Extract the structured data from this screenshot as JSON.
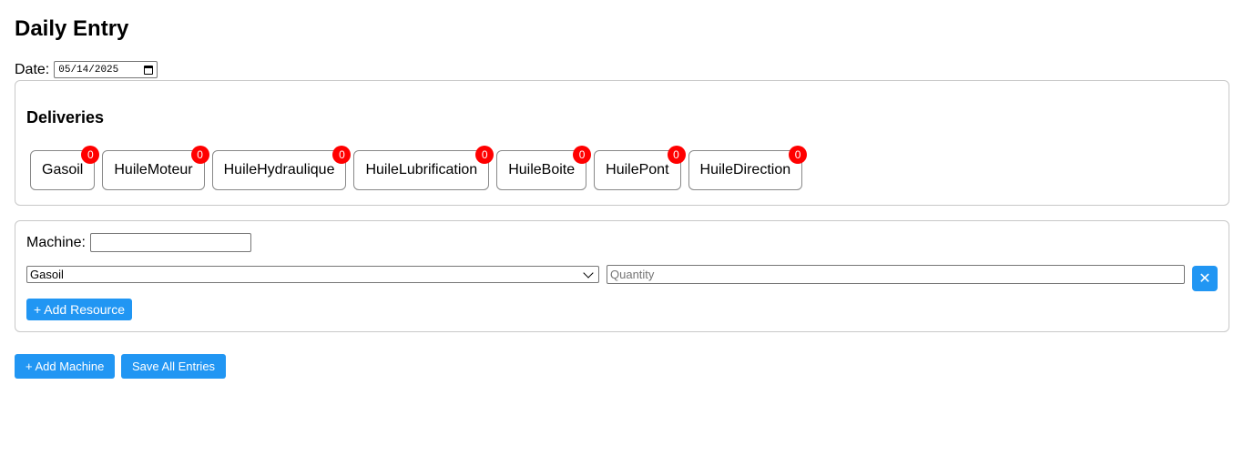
{
  "page": {
    "title": "Daily Entry"
  },
  "date": {
    "label": "Date:",
    "value": "05/14/2025"
  },
  "deliveries": {
    "title": "Deliveries",
    "items": [
      {
        "label": "Gasoil",
        "count": "0"
      },
      {
        "label": "HuileMoteur",
        "count": "0"
      },
      {
        "label": "HuileHydraulique",
        "count": "0"
      },
      {
        "label": "HuileLubrification",
        "count": "0"
      },
      {
        "label": "HuileBoite",
        "count": "0"
      },
      {
        "label": "HuilePont",
        "count": "0"
      },
      {
        "label": "HuileDirection",
        "count": "0"
      }
    ]
  },
  "machine": {
    "label": "Machine:",
    "value": "",
    "resource_selected": "Gasoil",
    "quantity_placeholder": "Quantity",
    "remove_symbol": "✕",
    "add_resource_label": "+ Add Resource"
  },
  "actions": {
    "add_machine_label": "+ Add Machine",
    "save_label": "Save All Entries"
  },
  "colors": {
    "accent": "#2196f3",
    "badge": "#ff0000"
  }
}
